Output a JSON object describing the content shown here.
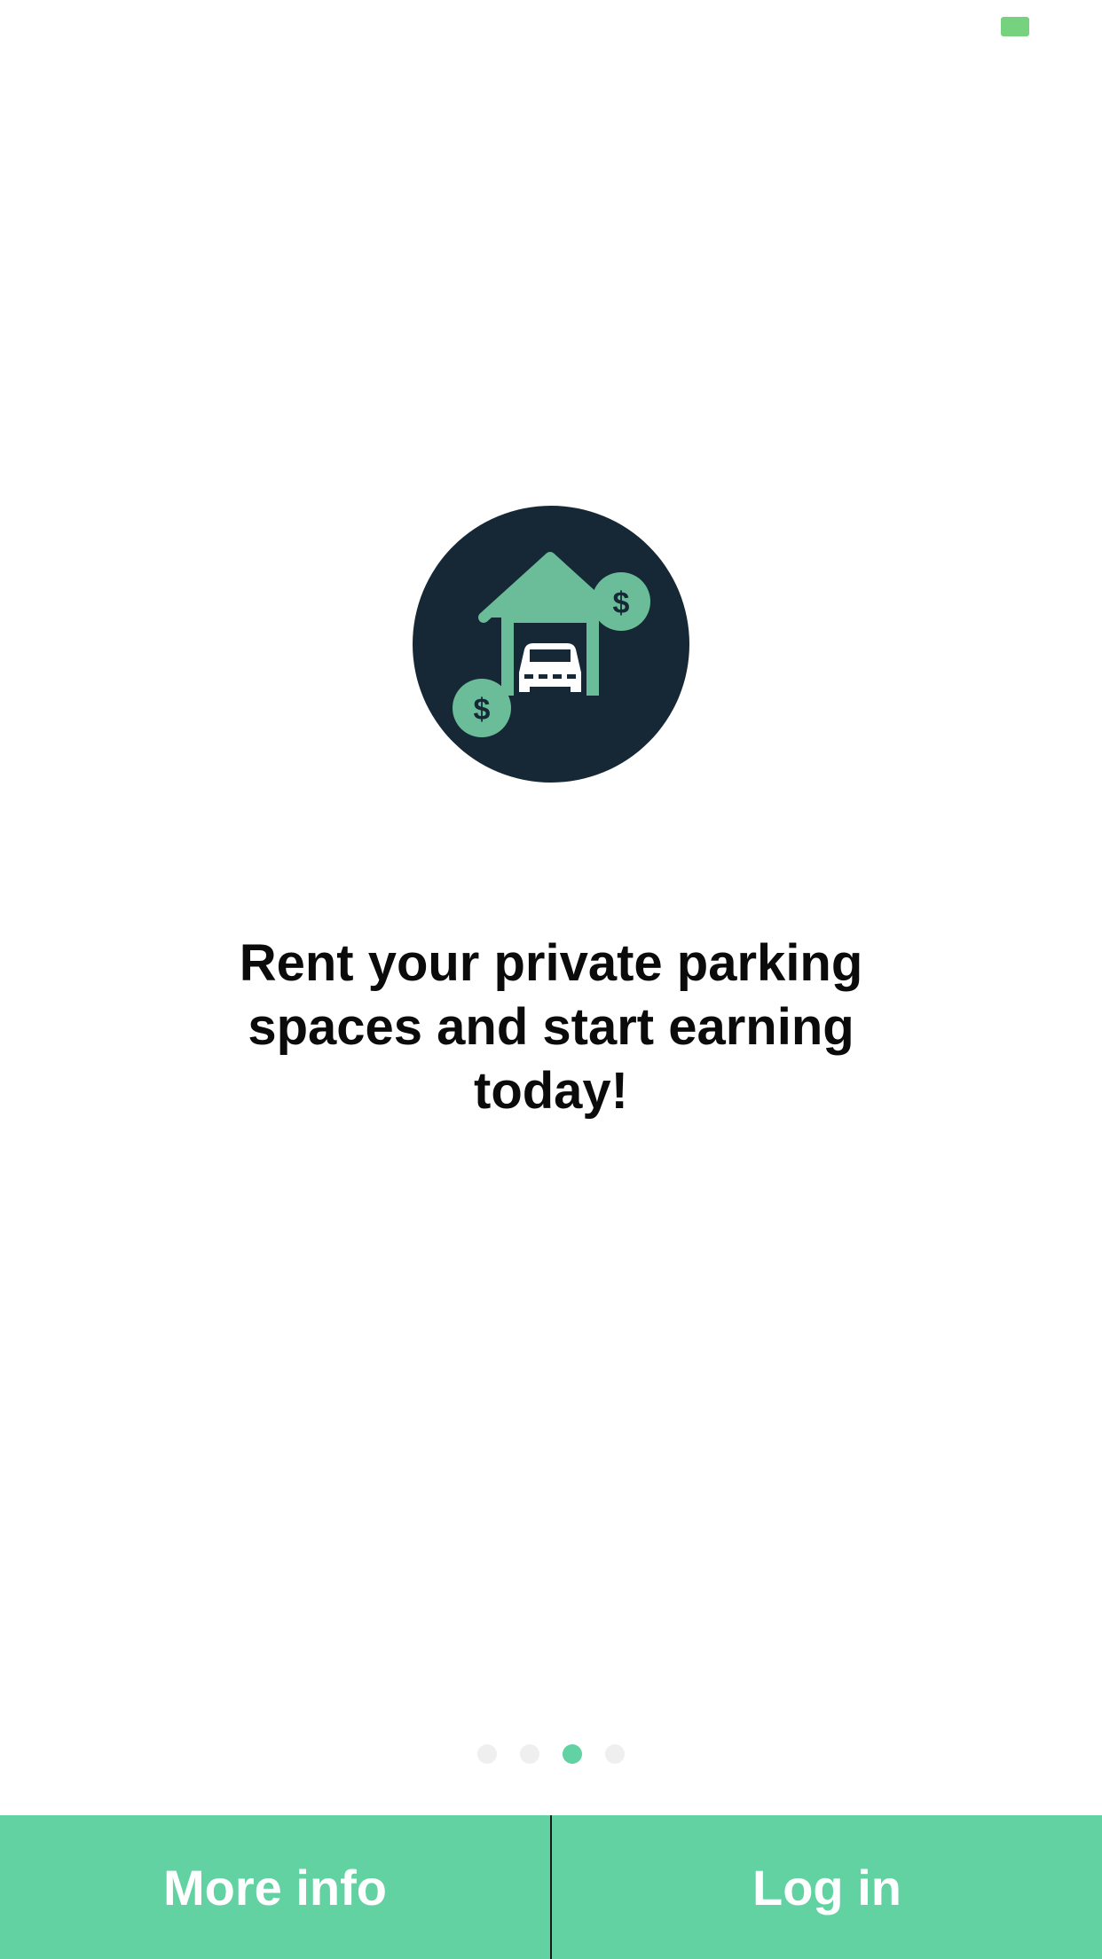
{
  "status_bar": {
    "battery_icon": "battery-icon",
    "battery_color": "#76d27e"
  },
  "onboarding": {
    "hero_icon": "garage-car-money-icon",
    "headline": "Rent your private parking spaces and start earning today!",
    "page_indicator": {
      "total_pages": 4,
      "current_page": 3
    }
  },
  "bottom_bar": {
    "more_info_label": "More info",
    "login_label": "Log in",
    "background_color": "#62d2a2"
  },
  "colors": {
    "accent": "#62d2a2",
    "icon_circle": "#162835",
    "icon_house": "#6bbd9a",
    "text": "#0b0b0b"
  }
}
